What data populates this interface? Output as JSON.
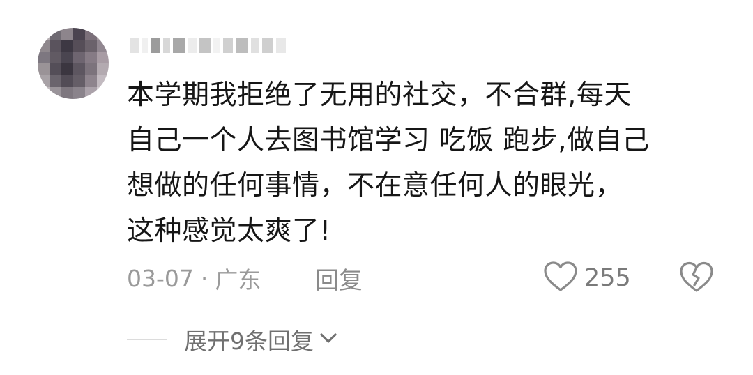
{
  "comment": {
    "username_blurred": true,
    "lines": [
      "本学期我拒绝了无用的社交，不合群,每天",
      "自己一个人去图书馆学习 吃饭 跑步,做自己",
      "想做的任何事情，不在意任何人的眼光，",
      "这种感觉太爽了!"
    ],
    "date": "03-07",
    "separator": "·",
    "location": "广东",
    "reply_label": "回复",
    "like_count": "255",
    "expand_label": "展开9条回复"
  },
  "icons": {
    "like": "heart-icon",
    "dislike": "broken-heart-icon",
    "expand": "chevron-down-icon"
  },
  "colors": {
    "text": "#161616",
    "meta": "#9a9a9a",
    "icon": "#8a8a8a"
  }
}
